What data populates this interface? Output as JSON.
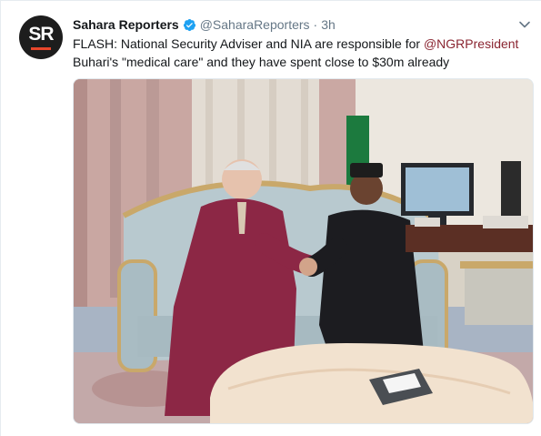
{
  "tweet": {
    "display_name": "Sahara Reporters",
    "handle": "@SaharaReporters",
    "separator": "·",
    "time": "3h",
    "avatar_text": "SR",
    "text_before": "FLASH: National Security Adviser and NIA are responsible for ",
    "mention": "@NGRPresident",
    "text_after": " Buhari's \"medical care\" and they have spent close to $30m already"
  },
  "icons": {
    "verified": "verified-badge-icon",
    "caret": "chevron-down-icon"
  },
  "colors": {
    "mention": "#8a2531",
    "verified": "#1da1f2",
    "secondary_text": "#657786"
  }
}
